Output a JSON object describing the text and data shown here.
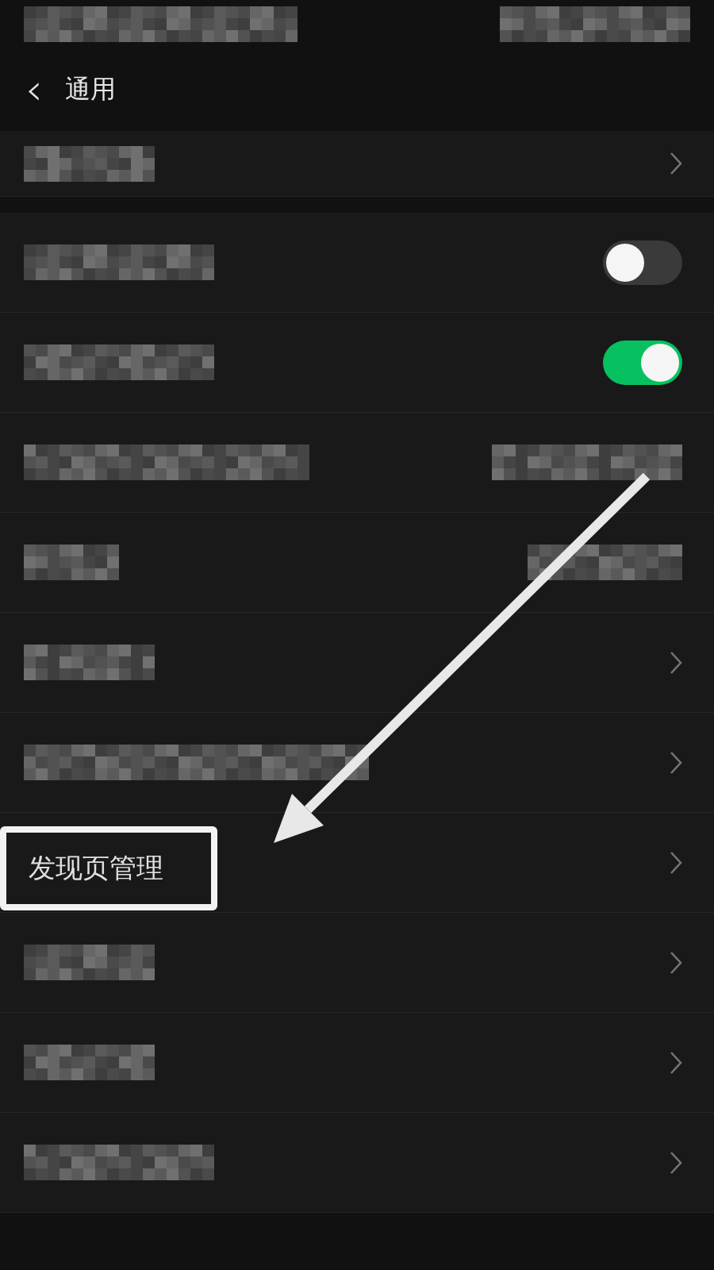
{
  "header": {
    "back_icon": "‹",
    "title": "通用"
  },
  "rows": [
    {
      "kind": "chevron",
      "separated": true
    },
    {
      "kind": "toggle",
      "on": false
    },
    {
      "kind": "toggle",
      "on": true
    },
    {
      "kind": "value"
    },
    {
      "kind": "value"
    },
    {
      "kind": "chevron"
    },
    {
      "kind": "chevron"
    },
    {
      "kind": "chevron",
      "label": "发现页管理",
      "highlighted": true
    },
    {
      "kind": "chevron"
    },
    {
      "kind": "chevron"
    },
    {
      "kind": "chevron"
    }
  ]
}
